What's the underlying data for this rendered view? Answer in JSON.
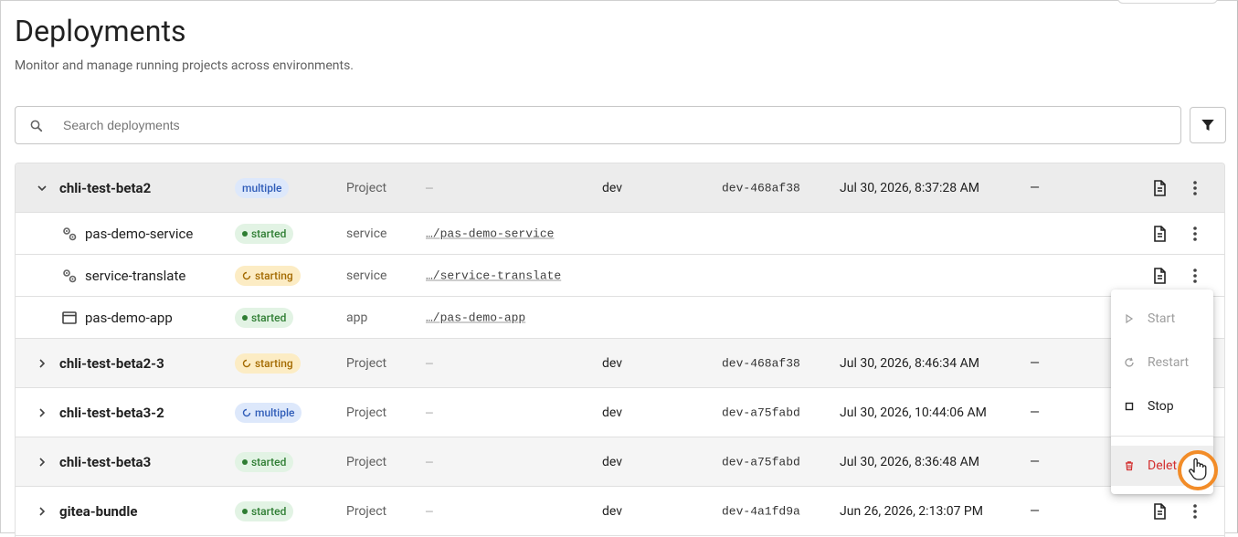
{
  "page": {
    "title": "Deployments",
    "subtitle": "Monitor and manage running projects across environments."
  },
  "search": {
    "placeholder": "Search deployments",
    "value": ""
  },
  "rows": [
    {
      "name": "chli-test-beta2",
      "status": "multiple",
      "kind": "Project",
      "path": "—",
      "env": "dev",
      "version": "dev-468af38",
      "date": "Jul 30, 2026, 8:37:28 AM",
      "extra": "—",
      "expanded": true
    },
    {
      "name": "pas-demo-service",
      "status": "started",
      "kind": "service",
      "path": "…/pas-demo-service"
    },
    {
      "name": "service-translate",
      "status": "starting",
      "kind": "service",
      "path": "…/service-translate"
    },
    {
      "name": "pas-demo-app",
      "status": "started",
      "kind": "app",
      "path": "…/pas-demo-app"
    },
    {
      "name": "chli-test-beta2-3",
      "status": "starting",
      "kind": "Project",
      "path": "—",
      "env": "dev",
      "version": "dev-468af38",
      "date": "Jul 30, 2026, 8:46:34 AM",
      "extra": "—"
    },
    {
      "name": "chli-test-beta3-2",
      "status": "multiple",
      "kind": "Project",
      "path": "—",
      "env": "dev",
      "version": "dev-a75fabd",
      "date": "Jul 30, 2026, 10:44:06 AM",
      "extra": "—"
    },
    {
      "name": "chli-test-beta3",
      "status": "started",
      "kind": "Project",
      "path": "—",
      "env": "dev",
      "version": "dev-a75fabd",
      "date": "Jul 30, 2026, 8:36:48 AM",
      "extra": "—"
    },
    {
      "name": "gitea-bundle",
      "status": "started",
      "kind": "Project",
      "path": "—",
      "env": "dev",
      "version": "dev-4a1fd9a",
      "date": "Jun 26, 2026, 2:13:07 PM",
      "extra": "—"
    }
  ],
  "menu": {
    "start": "Start",
    "restart": "Restart",
    "stop": "Stop",
    "delete": "Delete",
    "delete_visible": "Delet"
  },
  "colors": {
    "multiple": "#2f5cb8",
    "started": "#2e7d32",
    "starting": "#a36a00",
    "danger": "#d32f2f",
    "cursor_ring": "#f28c28"
  },
  "icons": {
    "search": "search-icon",
    "filter": "filter-icon",
    "expand": "chevron-icon",
    "service": "gears-icon",
    "app": "window-icon",
    "logs": "document-icon",
    "more": "more-vertical-icon"
  }
}
